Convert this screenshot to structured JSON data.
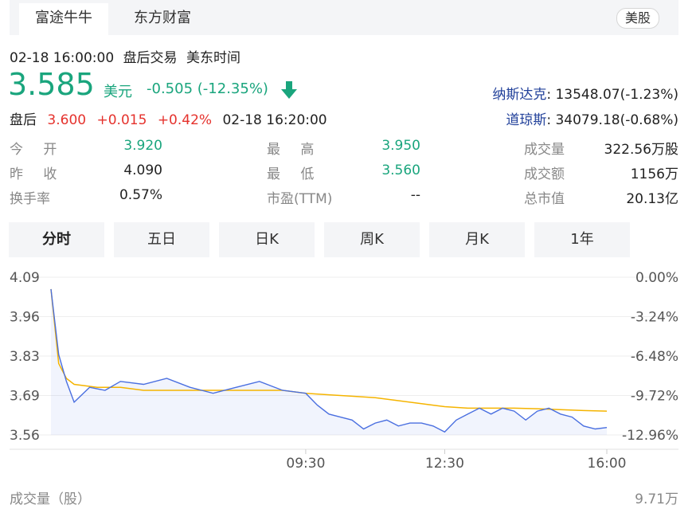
{
  "tabs": [
    {
      "label": "富途牛牛",
      "active": true
    },
    {
      "label": "东方财富",
      "active": false
    }
  ],
  "market_badge": "美股",
  "datetime_line": {
    "datetime": "02-18 16:00:00",
    "session": "盘后交易",
    "timezone": "美东时间"
  },
  "quote": {
    "price": "3.585",
    "currency": "美元",
    "change": "-0.505",
    "change_pct": "(-12.35%)"
  },
  "after_hours": {
    "label": "盘后",
    "price": "3.600",
    "change": "+0.015",
    "change_pct": "+0.42%",
    "time": "02-18 16:20:00"
  },
  "indices": [
    {
      "name": "纳斯达克",
      "value": ": 13548.07(-1.23%)"
    },
    {
      "name": "道琼斯",
      "value": ": 34079.18(-0.68%)"
    }
  ],
  "stats": {
    "open": {
      "label": "今 开",
      "value": "3.920"
    },
    "prev_close": {
      "label": "昨 收",
      "value": "4.090"
    },
    "turnover_rate": {
      "label": "换手率",
      "value": "0.57%"
    },
    "high": {
      "label": "最 高",
      "value": "3.950"
    },
    "low": {
      "label": "最 低",
      "value": "3.560"
    },
    "pe_ttm": {
      "label": "市盈(TTM)",
      "value": "--"
    },
    "volume": {
      "label": "成交量",
      "value": "322.56万股"
    },
    "amount": {
      "label": "成交额",
      "value": "1156万"
    },
    "market_cap": {
      "label": "总市值",
      "value": "20.13亿"
    }
  },
  "period_tabs": [
    {
      "label": "分时",
      "active": true
    },
    {
      "label": "五日",
      "active": false
    },
    {
      "label": "日K",
      "active": false
    },
    {
      "label": "周K",
      "active": false
    },
    {
      "label": "月K",
      "active": false
    },
    {
      "label": "1年",
      "active": false
    }
  ],
  "volume_section": {
    "label": "成交量（股）",
    "max": "9.71万"
  },
  "colors": {
    "up": "#e5322d",
    "down": "#1aa57d",
    "price_line": "#4a6fe0",
    "avg_line": "#f5b400",
    "link": "#21409a"
  },
  "chart_data": {
    "type": "line",
    "y_ticks": [
      "4.09",
      "3.96",
      "3.83",
      "3.69",
      "3.56"
    ],
    "pct_ticks": [
      "0.00%",
      "-3.24%",
      "-6.48%",
      "-9.72%",
      "-12.96%"
    ],
    "x_ticks": [
      "09:30",
      "12:30",
      "16:00"
    ],
    "ylim": [
      3.56,
      4.09
    ],
    "series": [
      {
        "role": "price",
        "x": [
          "04:00",
          "04:10",
          "04:20",
          "04:30",
          "04:50",
          "05:10",
          "05:30",
          "06:00",
          "06:30",
          "07:00",
          "07:30",
          "08:00",
          "08:30",
          "09:00",
          "09:30",
          "09:45",
          "10:00",
          "10:15",
          "10:30",
          "10:45",
          "11:00",
          "11:15",
          "11:30",
          "11:45",
          "12:00",
          "12:15",
          "12:30",
          "12:45",
          "13:00",
          "13:15",
          "13:30",
          "13:45",
          "14:00",
          "14:15",
          "14:30",
          "14:45",
          "15:00",
          "15:15",
          "15:30",
          "15:45",
          "16:00"
        ],
        "values": [
          4.05,
          3.83,
          3.74,
          3.67,
          3.72,
          3.71,
          3.74,
          3.73,
          3.75,
          3.72,
          3.7,
          3.72,
          3.74,
          3.71,
          3.7,
          3.66,
          3.63,
          3.62,
          3.61,
          3.58,
          3.6,
          3.61,
          3.59,
          3.6,
          3.6,
          3.59,
          3.57,
          3.61,
          3.63,
          3.65,
          3.63,
          3.65,
          3.64,
          3.61,
          3.64,
          3.65,
          3.63,
          3.62,
          3.59,
          3.58,
          3.585
        ]
      },
      {
        "role": "average",
        "x": [
          "04:00",
          "04:10",
          "04:20",
          "04:30",
          "05:00",
          "05:30",
          "06:00",
          "07:00",
          "08:00",
          "09:00",
          "09:30",
          "10:00",
          "10:30",
          "11:00",
          "11:30",
          "12:00",
          "12:30",
          "13:00",
          "13:30",
          "14:00",
          "14:30",
          "15:00",
          "15:30",
          "16:00"
        ],
        "values": [
          4.05,
          3.8,
          3.75,
          3.73,
          3.72,
          3.72,
          3.71,
          3.71,
          3.71,
          3.71,
          3.7,
          3.695,
          3.69,
          3.685,
          3.675,
          3.665,
          3.655,
          3.65,
          3.65,
          3.65,
          3.648,
          3.645,
          3.642,
          3.64
        ]
      }
    ]
  }
}
